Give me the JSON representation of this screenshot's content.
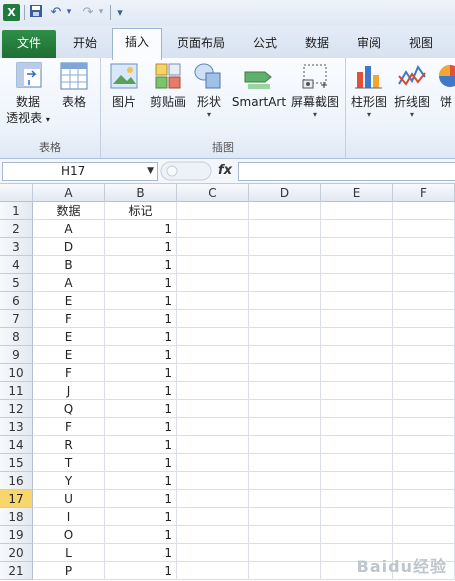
{
  "quick_access": {
    "undo_glyph": "↶",
    "redo_glyph": "↷",
    "customize_glyph": "▾"
  },
  "ribbon_tabs": [
    "文件",
    "开始",
    "插入",
    "页面布局",
    "公式",
    "数据",
    "审阅",
    "视图"
  ],
  "active_tab": "插入",
  "groups": {
    "tables": {
      "label": "表格",
      "pivot_line1": "数据",
      "pivot_line2": "透视表",
      "table": "表格"
    },
    "illustrations": {
      "label": "插图",
      "picture": "图片",
      "clipart": "剪贴画",
      "shapes": "形状",
      "smartart": "SmartArt",
      "screenshot": "屏幕截图"
    },
    "charts": {
      "column": "柱形图",
      "line": "折线图",
      "pie": "饼"
    }
  },
  "formula_bar": {
    "name_box": "H17",
    "fx_label": "fx",
    "value": ""
  },
  "sheet": {
    "columns": [
      "A",
      "B",
      "C",
      "D",
      "E",
      "F"
    ],
    "rows": [
      [
        "数据",
        "标记"
      ],
      [
        "A",
        "1"
      ],
      [
        "D",
        "1"
      ],
      [
        "B",
        "1"
      ],
      [
        "A",
        "1"
      ],
      [
        "E",
        "1"
      ],
      [
        "F",
        "1"
      ],
      [
        "E",
        "1"
      ],
      [
        "E",
        "1"
      ],
      [
        "F",
        "1"
      ],
      [
        "J",
        "1"
      ],
      [
        "Q",
        "1"
      ],
      [
        "F",
        "1"
      ],
      [
        "R",
        "1"
      ],
      [
        "T",
        "1"
      ],
      [
        "Y",
        "1"
      ],
      [
        "U",
        "1"
      ],
      [
        "I",
        "1"
      ],
      [
        "O",
        "1"
      ],
      [
        "L",
        "1"
      ],
      [
        "P",
        "1"
      ]
    ],
    "selected_row": 17
  },
  "watermark": "Baidu经验"
}
